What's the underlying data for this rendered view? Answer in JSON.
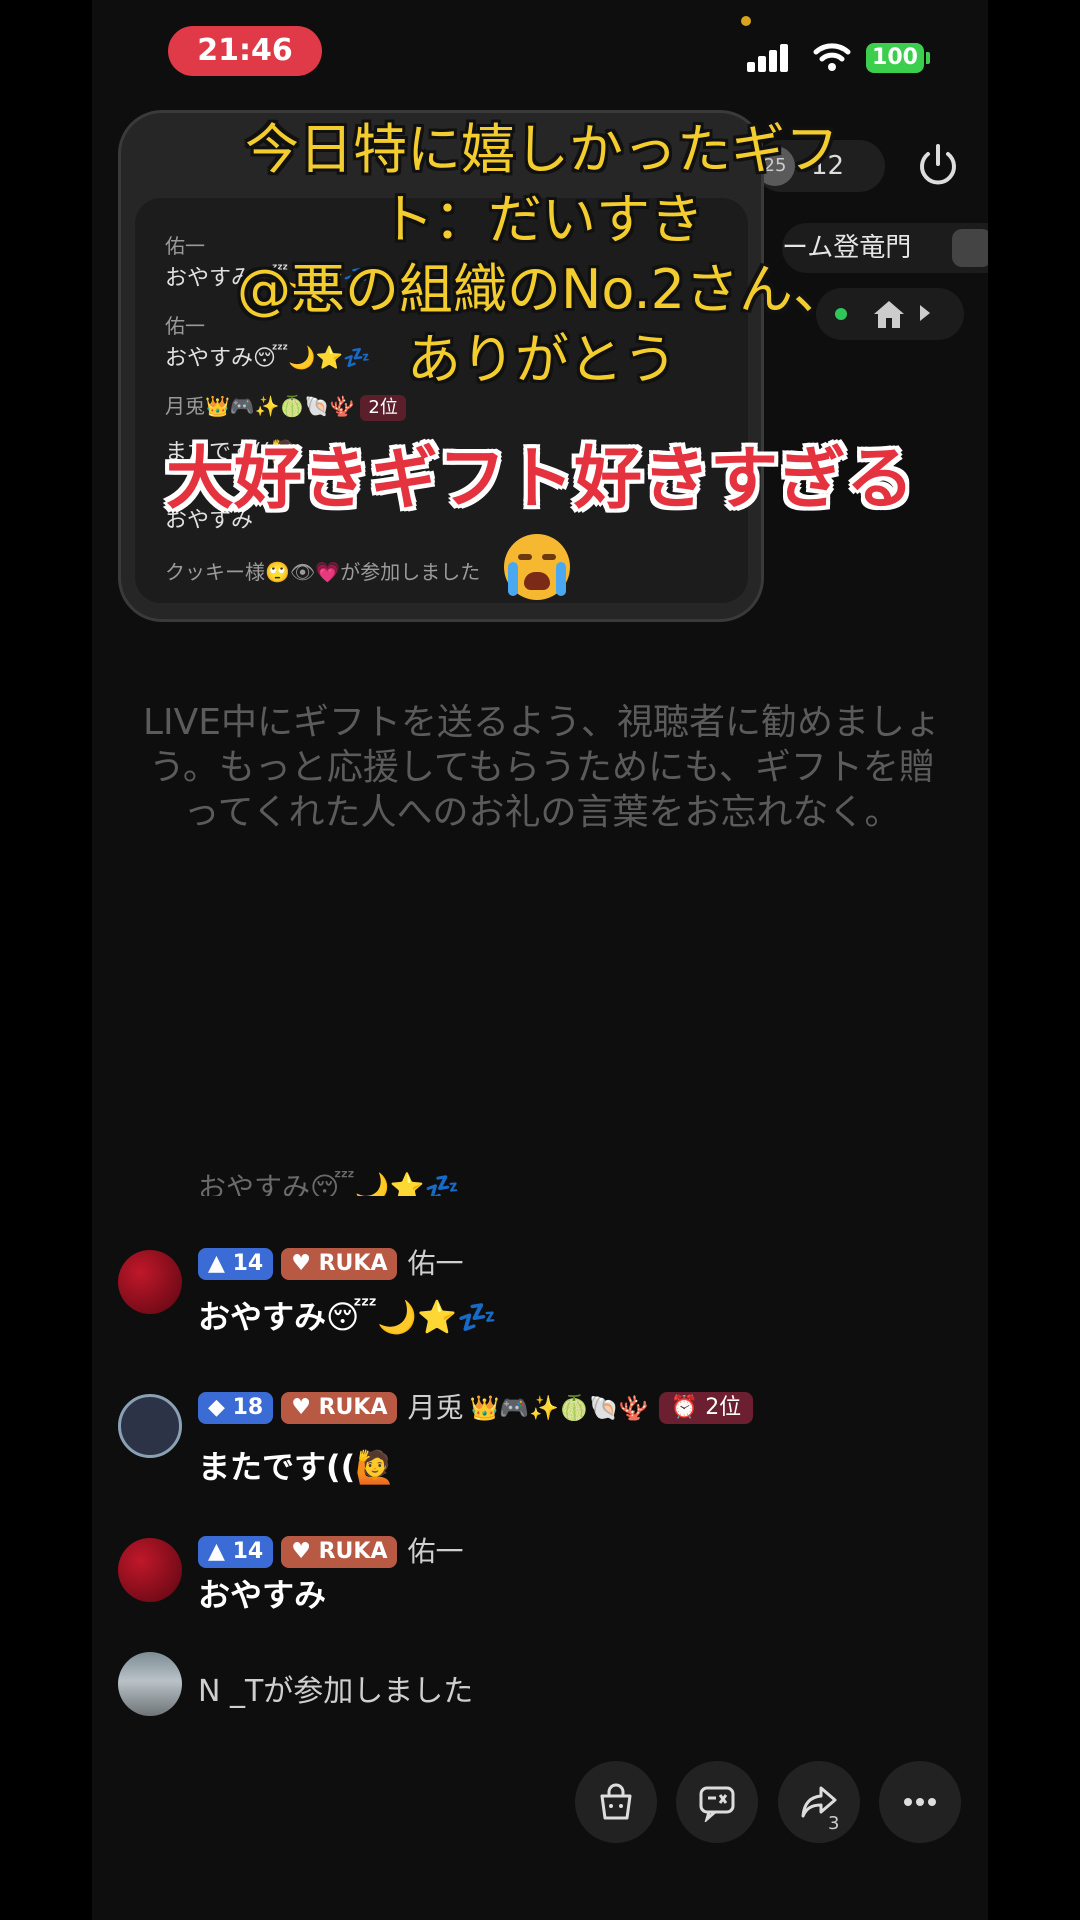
{
  "status_bar": {
    "time": "21:46",
    "battery": "100"
  },
  "viewers": {
    "count": "12",
    "avatar_text": "25"
  },
  "room": {
    "label": "ーム登竜門"
  },
  "pip": {
    "lines": [
      {
        "text": "佑一",
        "kind": "name"
      },
      {
        "text": "おやすみ😴🌙⭐💤",
        "kind": "msg"
      },
      {
        "text": "佑一",
        "kind": "name"
      },
      {
        "text": "おやすみ😴🌙⭐💤",
        "kind": "msg"
      },
      {
        "text": "月兎👑🎮✨🍈🐚🪸",
        "kind": "name"
      },
      {
        "text": "またです((🙋",
        "kind": "msg"
      },
      {
        "text": "おやすみ",
        "kind": "msg"
      },
      {
        "text": "クッキー様🙄👁💗が参加しました",
        "kind": "name"
      }
    ],
    "rank": "2位"
  },
  "captions": {
    "yellow_line1": "今日特に嬉しかったギフ",
    "yellow_line2": "ト：だいすき",
    "yellow_line3": "@悪の組織のNo.2さん、",
    "yellow_line4": "ありがとう",
    "red": "大好きギフト好きすぎる"
  },
  "hint": "LIVE中にギフトを送るよう、視聴者に勧めましょう。もっと応援してもらうためにも、ギフトを贈ってくれた人へのお礼の言葉をお忘れなく。",
  "comments": {
    "cut_text": "おやすみ😴🌙⭐💤",
    "items": [
      {
        "level": "14",
        "ruka": "RUKA",
        "name": "佑一",
        "text": "おやすみ😴🌙⭐💤"
      },
      {
        "level": "18",
        "ruka": "RUKA",
        "name": "月兎",
        "deco": "👑🎮✨🍈🐚🪸",
        "rank": "2位",
        "text": "またです((🙋"
      },
      {
        "level": "14",
        "ruka": "RUKA",
        "name": "佑一",
        "text": "おやすみ"
      }
    ],
    "joined": "N _Tが参加しました"
  },
  "bottom_bar": {
    "share_count": "3",
    "icons": [
      "shopping-bag-icon",
      "gift-chat-icon",
      "share-icon",
      "more-icon"
    ]
  }
}
